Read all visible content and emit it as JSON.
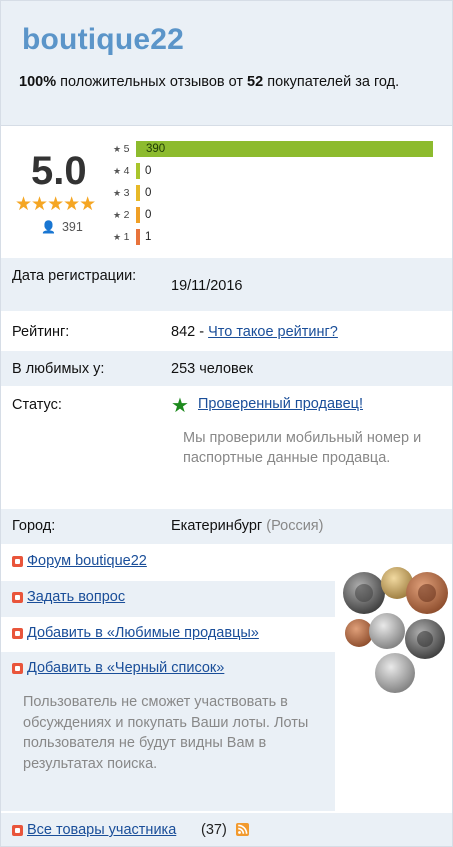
{
  "header": {
    "shop_name": "boutique22",
    "feedback_percent": "100%",
    "feedback_text_a": " положительных отзывов от ",
    "feedback_count": "52",
    "feedback_text_b": " покупателей за год."
  },
  "rating": {
    "score": "5.0",
    "stars": "★★★★★",
    "votes": "391",
    "breakdown": [
      {
        "label": "5",
        "count": "390",
        "value": 390,
        "color": "#8dbb2e"
      },
      {
        "label": "4",
        "count": "0",
        "value": 0,
        "color": "#a9c52c"
      },
      {
        "label": "3",
        "count": "0",
        "value": 0,
        "color": "#e7b928"
      },
      {
        "label": "2",
        "count": "0",
        "value": 0,
        "color": "#f0a026"
      },
      {
        "label": "1",
        "count": "1",
        "value": 1,
        "color": "#e8733b"
      }
    ]
  },
  "info": {
    "reg_label": "Дата регистрации:",
    "reg_value": "19/11/2016",
    "rating_label": "Рейтинг:",
    "rating_value": "842 - ",
    "rating_link": "Что такое рейтинг?",
    "fav_label": "В любимых у:",
    "fav_value": "253 человек",
    "status_label": "Статус:",
    "status_link": "Проверенный продавец!",
    "status_desc": "Мы проверили мобильный номер и паспортные данные продавца.",
    "city_label": "Город:",
    "city_value": "Екатеринбург",
    "country_value": "(Россия)"
  },
  "actions": {
    "forum": "Форум boutique22",
    "ask": "Задать вопрос",
    "add_fav": "Добавить в «Любимые продавцы»",
    "add_black": "Добавить в «Черный список»",
    "black_desc": "Пользователь не сможет участвовать в обсуждениях и покупать Ваши лоты. Лоты пользователя не будут видны Вам в результатах поиска.",
    "all_items": "Все товары участника",
    "all_count": "(37)"
  },
  "colors": {
    "accent": "#5b95c9",
    "link": "#1a4e99",
    "verified": "#1e8a1e",
    "row_alt": "#eaf0f6"
  }
}
